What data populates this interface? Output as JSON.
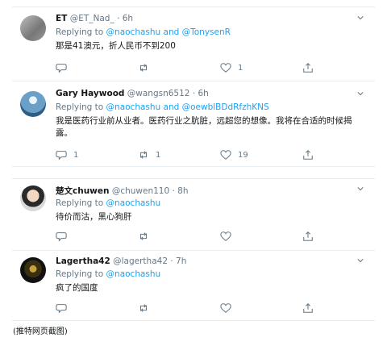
{
  "tweets": [
    {
      "name": "ET",
      "handle": "@ET_Nad_",
      "time": "· 6h",
      "replying_prefix": "Replying to",
      "mentions": "@naochashu and @TonysenR",
      "text": "那是41澳元，折人民币不到200",
      "counts": {
        "reply": "",
        "retweet": "",
        "like": "1"
      }
    },
    {
      "name": "Gary Haywood",
      "handle": "@wangsn6512",
      "time": "· 6h",
      "replying_prefix": "Replying to",
      "mentions": "@naochashu and @oewblBDdRfzhKNS",
      "text": "我是医药行业前从业者。医药行业之肮脏，远超您的想像。我将在合适的时候揭露。",
      "counts": {
        "reply": "1",
        "retweet": "1",
        "like": "19"
      }
    },
    {
      "name": "楚文chuwen",
      "handle": "@chuwen110",
      "time": "· 8h",
      "replying_prefix": "Replying to",
      "mentions": "@naochashu",
      "text": "待价而沽，黑心狗肝",
      "counts": {
        "reply": "",
        "retweet": "",
        "like": ""
      }
    },
    {
      "name": "Lagertha42",
      "handle": "@lagertha42",
      "time": "· 7h",
      "replying_prefix": "Replying to",
      "mentions": "@naochashu",
      "text": "疯了的国度",
      "counts": {
        "reply": "",
        "retweet": "",
        "like": ""
      }
    }
  ],
  "caption": "(推特网页截图)",
  "colors": {
    "link": "#1da1f2",
    "muted": "#657786",
    "border": "#e6ecf0"
  },
  "icons": [
    "reply-icon",
    "retweet-icon",
    "like-icon",
    "share-icon",
    "chevron-down-icon"
  ]
}
